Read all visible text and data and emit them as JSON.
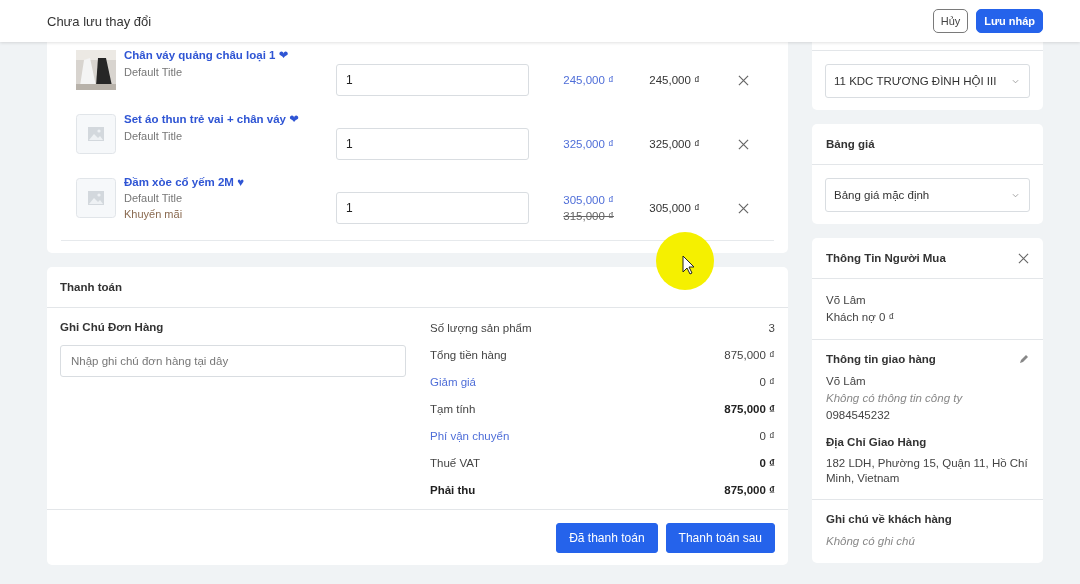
{
  "header": {
    "title": "Chưa lưu thay đổi",
    "buttons": [
      {
        "label": "Hủy",
        "kind": "secondary"
      },
      {
        "label": "Lưu nháp",
        "kind": "primary"
      }
    ]
  },
  "products": [
    {
      "name": "Chân váy quảng châu loại 1 ❤",
      "variant": "Default Title",
      "quantity": "1",
      "price": "245,000 ₫",
      "total": "245,000 ₫"
    },
    {
      "name": "Set áo thun trẻ vai + chân váy ❤",
      "variant": "Default Title",
      "kind": "placeholder",
      "quantity": "1",
      "price": "325,000 ₫",
      "total": "325,000 ₫"
    },
    {
      "name": "Đầm xòe cổ yếm 2M ♥",
      "variant": "Default Title",
      "promo": "Khuyến mãi",
      "kind": "placeholder",
      "quantity": "1",
      "price": "305,000 ₫",
      "old_price": "315,000 ₫",
      "total": "305,000 ₫"
    }
  ],
  "payment": {
    "title": "Thanh toán",
    "note_label": "Ghi Chú Đơn Hàng",
    "note_placeholder": "Nhập ghi chú đơn hàng tại dây",
    "summary": [
      {
        "label": "Số lượng sản phẩm",
        "value": "3",
        "kind": "plain"
      },
      {
        "label": "Tổng tiền hàng",
        "value": "875,000 ₫",
        "kind": "plain"
      },
      {
        "label": "Giảm giá",
        "value": "0 ₫",
        "kind": "link"
      },
      {
        "label": "Tạm tính",
        "value": "875,000 ₫",
        "kind": "bold_value"
      },
      {
        "label": "Phí vận chuyển",
        "value": "0 ₫",
        "kind": "link"
      },
      {
        "label": "Thuế VAT",
        "value": "0 ₫",
        "kind": "bold_value"
      },
      {
        "label": "Phải thu",
        "value": "875,000 ₫",
        "kind": "total"
      }
    ],
    "buttons": [
      "Đã thanh toán",
      "Thanh toán sau"
    ]
  },
  "branch": {
    "value": "11 KDC TRƯƠNG ĐÌNH HỘI III"
  },
  "price_list": {
    "title": "Bảng giá",
    "value": "Bảng giá mặc định"
  },
  "buyer": {
    "title": "Thông Tin Người Mua",
    "name": "Võ Lâm",
    "debt": "Khách nợ 0 ₫",
    "shipping_title": "Thông tin giao hàng",
    "ship_name": "Võ Lâm",
    "company": "Không có thông tin công ty",
    "phone": "0984545232",
    "address_title": "Địa Chỉ Giao Hàng",
    "address": "182 LDH, Phường 15, Quận 11, Hồ Chí Minh, Vietnam",
    "note_title": "Ghi chú về khách hàng",
    "note": "Không có ghi chú"
  }
}
